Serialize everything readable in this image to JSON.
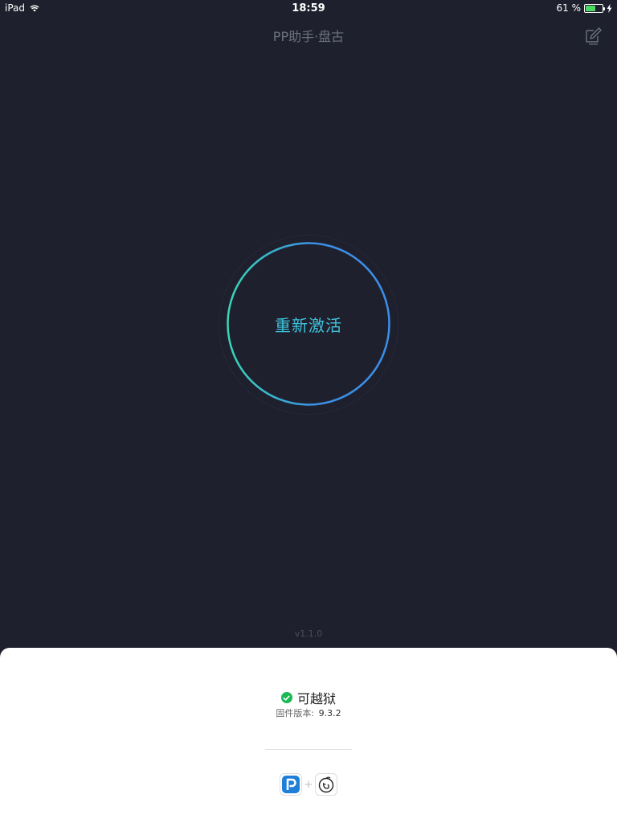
{
  "status_bar": {
    "device": "iPad",
    "time": "18:59",
    "battery_text": "61 %",
    "battery_level": 0.61,
    "battery_color": "#4cd964"
  },
  "nav": {
    "title": "PP助手·盘古",
    "edit_icon": "edit-note-icon"
  },
  "main": {
    "activate_label": "重新激活",
    "ring_gradient": [
      "#3ad6b6",
      "#3b8fe8"
    ],
    "version": "v1.1.0"
  },
  "sheet": {
    "status_text": "可越狱",
    "status_icon": "check-circle-icon",
    "firmware_label": "固件版本:",
    "firmware_value": "9.3.2",
    "plus": "+",
    "logos": [
      "pp-logo-icon",
      "pangu-logo-icon"
    ]
  },
  "colors": {
    "background": "#1f202d",
    "accent": "#3ec3dc",
    "success": "#19b955"
  }
}
